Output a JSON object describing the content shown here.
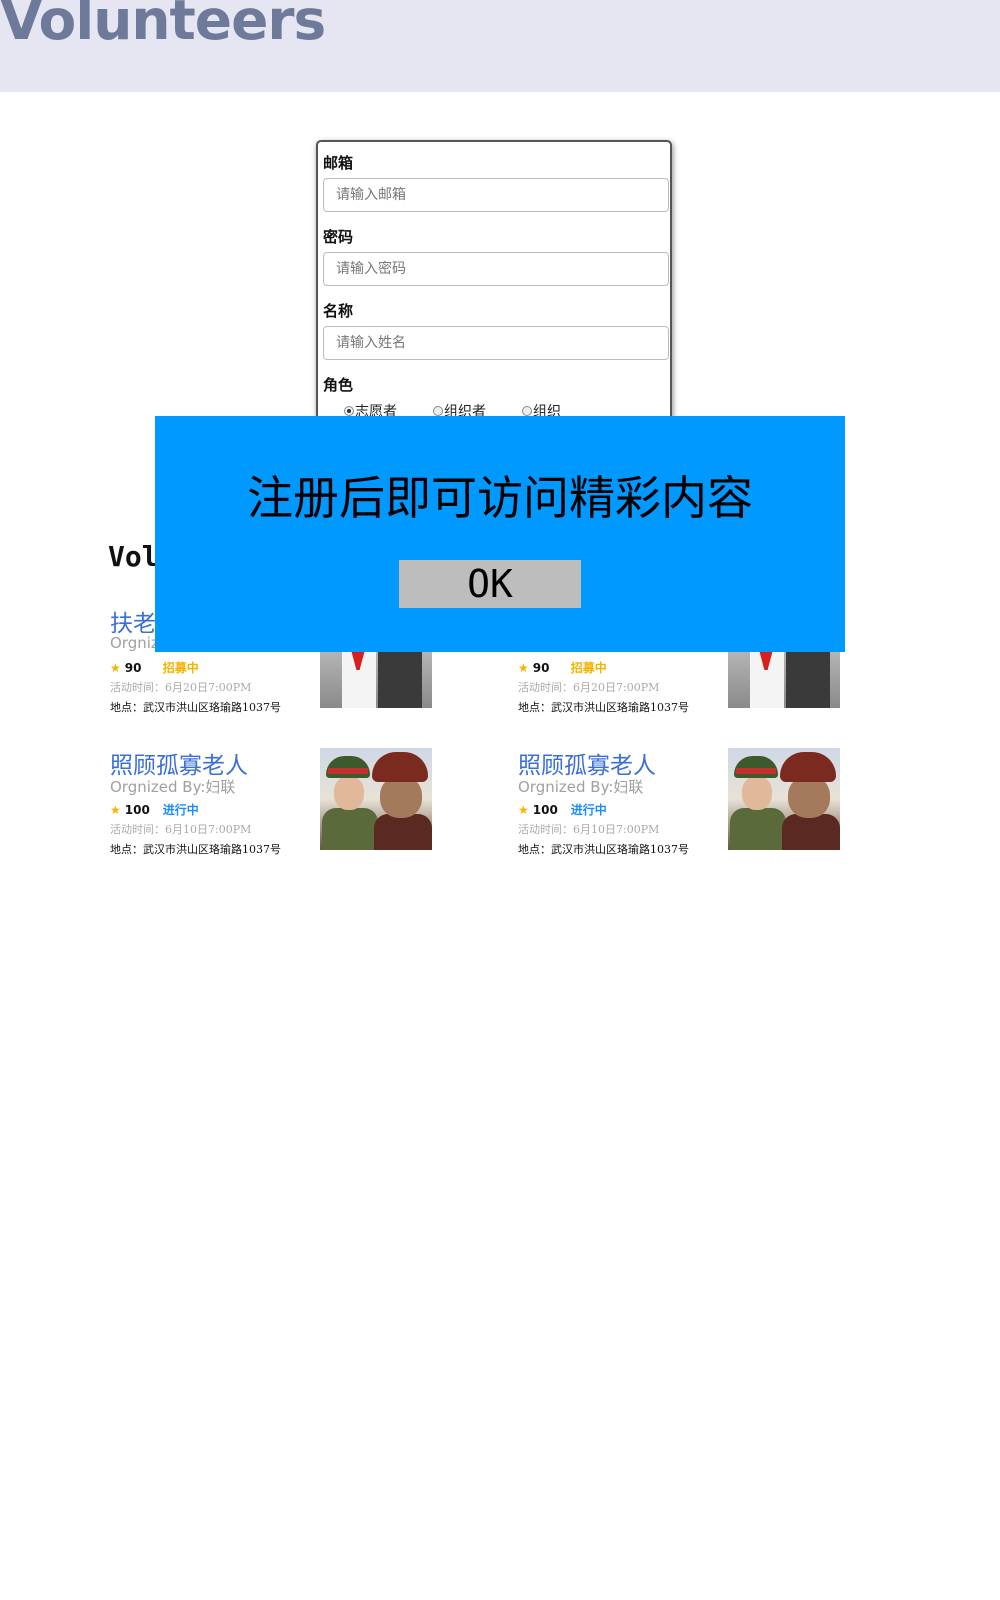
{
  "header": {
    "title": "Volunteers"
  },
  "form": {
    "email_label": "邮箱",
    "email_placeholder": "请输入邮箱",
    "password_label": "密码",
    "password_placeholder": "请输入密码",
    "name_label": "名称",
    "name_placeholder": "请输入姓名",
    "role_label": "角色",
    "roles": [
      {
        "label": "志愿者",
        "checked": true
      },
      {
        "label": "组织者",
        "checked": false
      },
      {
        "label": "组织",
        "checked": false
      }
    ]
  },
  "section": {
    "title": "Vol"
  },
  "cards": [
    {
      "title": "扶老",
      "org": "Orgniz",
      "score": "90",
      "status": "招募中",
      "status_color": "#f5b400",
      "time": "活动时间：6月20日7:00PM",
      "address": "地点：武汉市洪山区珞瑜路1037号",
      "photo": "kids-with-elder"
    },
    {
      "title": "",
      "org": "",
      "score": "90",
      "status": "招募中",
      "status_color": "#f5b400",
      "time": "活动时间：6月20日7:00PM",
      "address": "地点：武汉市洪山区珞瑜路1037号",
      "photo": "kids-with-elder"
    },
    {
      "title": "照顾孤寡老人",
      "org": "Orgnized By:妇联",
      "score": "100",
      "status": "进行中",
      "status_color": "#1a8cff",
      "time": "活动时间：6月10日7:00PM",
      "address": "地点：武汉市洪山区珞瑜路1037号",
      "photo": "soldier-with-elder"
    },
    {
      "title": "照顾孤寡老人",
      "org": "Orgnized By:妇联",
      "score": "100",
      "status": "进行中",
      "status_color": "#1a8cff",
      "time": "活动时间：6月10日7:00PM",
      "address": "地点：武汉市洪山区珞瑜路1037号",
      "photo": "soldier-with-elder"
    }
  ],
  "overlay": {
    "message": "注册后即可访问精彩内容",
    "ok_label": "OK",
    "background": "#0099ff"
  },
  "colors": {
    "header_bg": "#e6e6f2",
    "header_text": "#6e7a99",
    "card_title": "#3a6fd8"
  }
}
